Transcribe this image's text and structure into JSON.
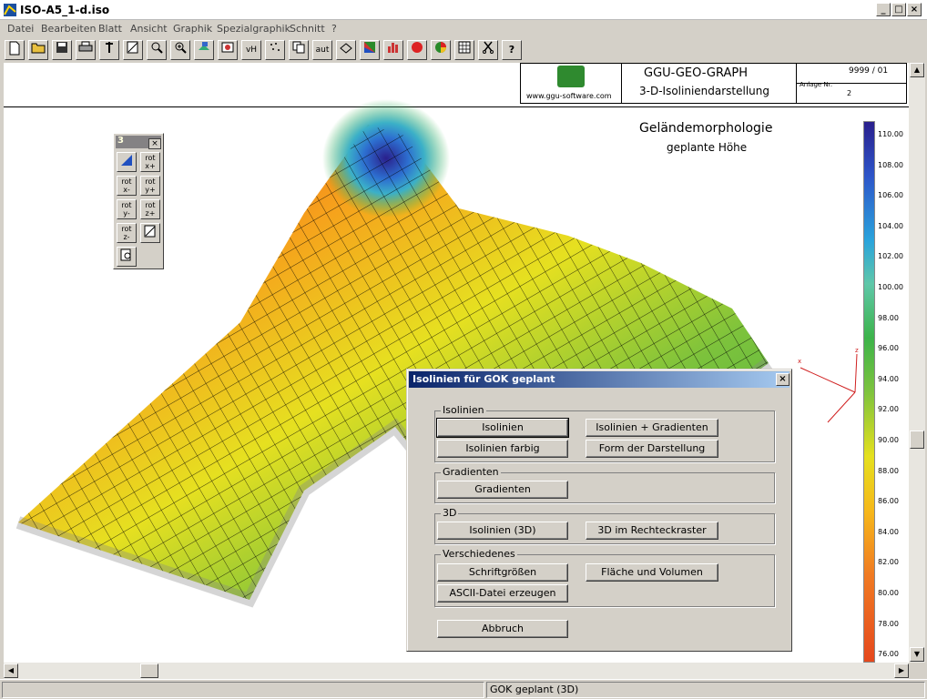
{
  "window": {
    "title": "ISO-A5_1-d.iso"
  },
  "menu": [
    "Datei",
    "Bearbeiten",
    "Blatt",
    "Ansicht",
    "Graphik",
    "Spezialgraphik",
    "Schnitt",
    "?"
  ],
  "toolbar": {
    "vh_label": "vH",
    "aut_label": "aut",
    "help_label": "?"
  },
  "header": {
    "app_name": "GGU-GEO-GRAPH",
    "subtitle": "3-D-Isoliniendarstellung",
    "website": "www.ggu-software.com",
    "project_number": "9999 / 01",
    "anlage_label": "Anlage Nr.",
    "anlage_value": "2"
  },
  "plot": {
    "title": "Geländemorphologie",
    "subtitle": "geplante Höhe"
  },
  "legend": {
    "values": [
      "110.00",
      "108.00",
      "106.00",
      "104.00",
      "102.00",
      "100.00",
      "98.00",
      "96.00",
      "94.00",
      "92.00",
      "90.00",
      "88.00",
      "86.00",
      "84.00",
      "82.00",
      "80.00",
      "78.00",
      "76.00"
    ]
  },
  "rotation_panel": {
    "tab_label": "3",
    "buttons": [
      "rot x+",
      "rot x-",
      "rot y+",
      "rot y-",
      "rot z+",
      "rot z-"
    ]
  },
  "axes": {
    "x": "x",
    "z": "z"
  },
  "dialog": {
    "title": "Isolinien für GOK geplant",
    "groups": {
      "isolinien": {
        "label": "Isolinien",
        "isolinien": "Isolinien",
        "isolinien_gradienten": "Isolinien + Gradienten",
        "isolinien_farbig": "Isolinien farbig",
        "form_darstellung": "Form der Darstellung"
      },
      "gradienten": {
        "label": "Gradienten",
        "gradienten": "Gradienten"
      },
      "three_d": {
        "label": "3D",
        "isolinien_3d": "Isolinien (3D)",
        "rechteckraster": "3D im Rechteckraster"
      },
      "verschiedenes": {
        "label": "Verschiedenes",
        "schriftgroessen": "Schriftgrößen",
        "flaeche_volumen": "Fläche und Volumen",
        "ascii": "ASCII-Datei erzeugen"
      }
    },
    "abbruch": "Abbruch"
  },
  "status": {
    "text": "GOK geplant (3D)"
  }
}
